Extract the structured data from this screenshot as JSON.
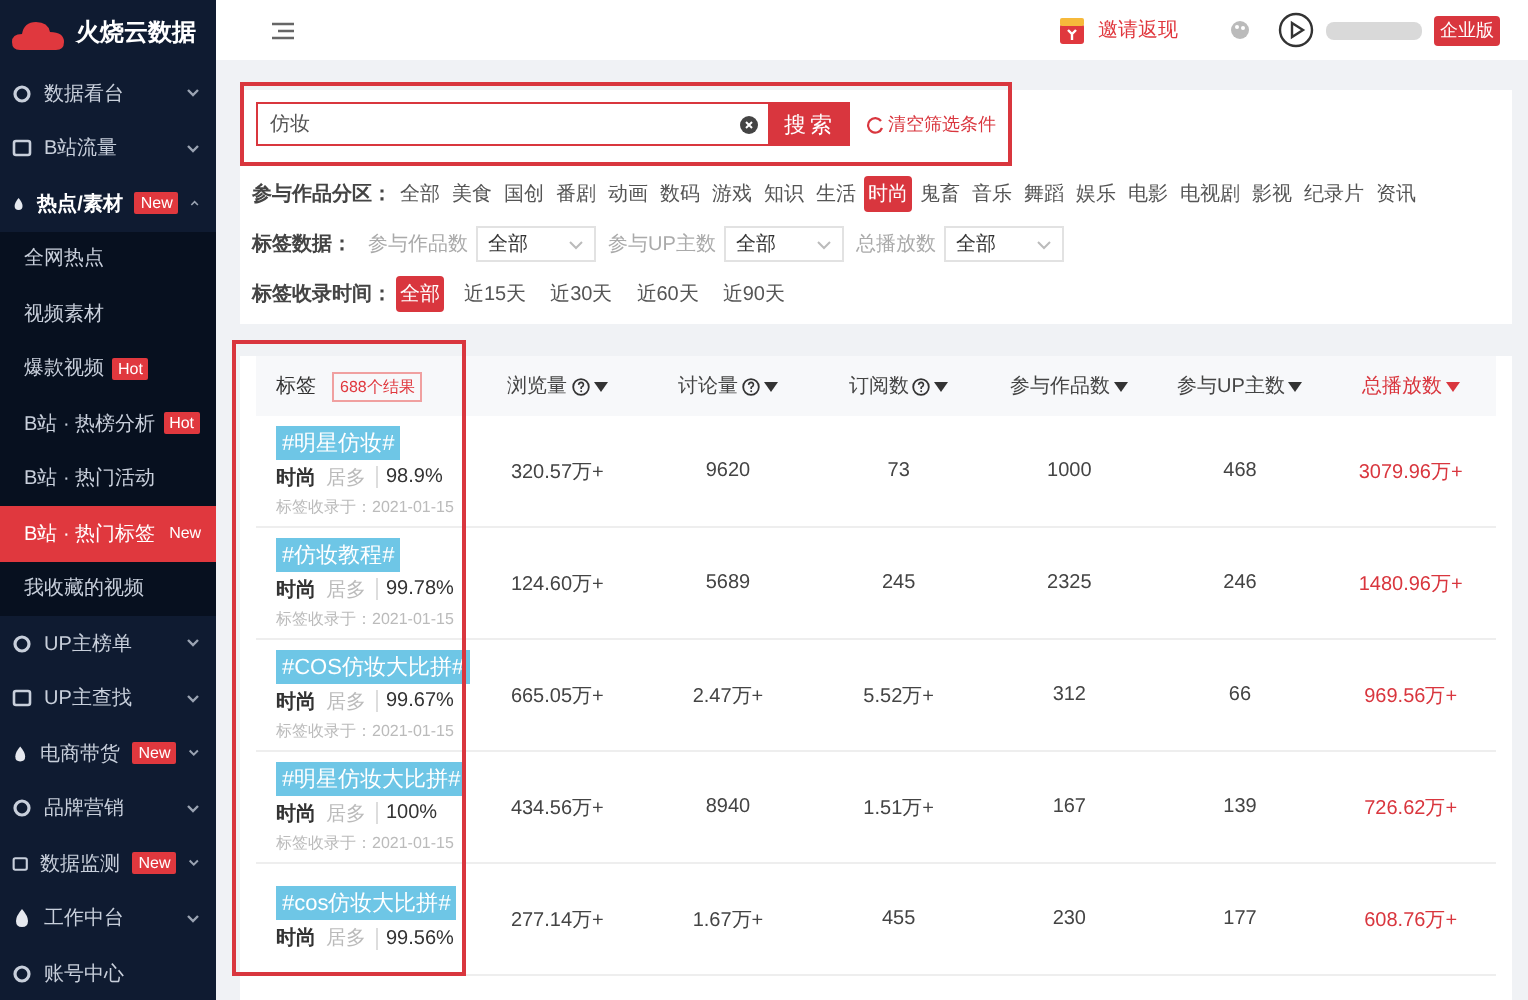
{
  "brand": "火烧云数据",
  "sidebar": {
    "items": [
      {
        "label": "数据看台",
        "expanded": false,
        "selected": false
      },
      {
        "label": "B站流量",
        "expanded": false,
        "selected": false
      },
      {
        "label": "热点/素材",
        "badge": "New",
        "expanded": true,
        "selected": false,
        "children": [
          {
            "label": "全网热点",
            "selected": false
          },
          {
            "label": "视频素材",
            "selected": false
          },
          {
            "label": "爆款视频",
            "badge": "Hot",
            "selected": false
          },
          {
            "label": "B站 · 热榜分析",
            "badge": "Hot",
            "selected": false
          },
          {
            "label": "B站 · 热门活动",
            "selected": false
          },
          {
            "label": "B站 · 热门标签",
            "badge": "New",
            "selected": true
          },
          {
            "label": "我收藏的视频",
            "selected": false
          }
        ]
      },
      {
        "label": "UP主榜单",
        "expanded": false,
        "selected": false
      },
      {
        "label": "UP主查找",
        "expanded": false,
        "selected": false
      },
      {
        "label": "电商带货",
        "badge": "New",
        "expanded": false,
        "selected": false
      },
      {
        "label": "品牌营销",
        "expanded": false,
        "selected": false
      },
      {
        "label": "数据监测",
        "badge": "New",
        "expanded": false,
        "selected": false
      },
      {
        "label": "工作中台",
        "expanded": false,
        "selected": false
      },
      {
        "label": "账号中心",
        "selected": false
      }
    ]
  },
  "topbar": {
    "invite": "邀请返现",
    "edition": "企业版"
  },
  "search": {
    "value": "仿妆",
    "button": "搜索",
    "reset": "清空筛选条件"
  },
  "category": {
    "label": "参与作品分区：",
    "options": [
      {
        "label": "全部",
        "selected": false
      },
      {
        "label": "美食",
        "selected": false
      },
      {
        "label": "国创",
        "selected": false
      },
      {
        "label": "番剧",
        "selected": false
      },
      {
        "label": "动画",
        "selected": false
      },
      {
        "label": "数码",
        "selected": false
      },
      {
        "label": "游戏",
        "selected": false
      },
      {
        "label": "知识",
        "selected": false
      },
      {
        "label": "生活",
        "selected": false
      },
      {
        "label": "时尚",
        "selected": true
      },
      {
        "label": "鬼畜",
        "selected": false
      },
      {
        "label": "音乐",
        "selected": false
      },
      {
        "label": "舞蹈",
        "selected": false
      },
      {
        "label": "娱乐",
        "selected": false
      },
      {
        "label": "电影",
        "selected": false
      },
      {
        "label": "电视剧",
        "selected": false
      },
      {
        "label": "影视",
        "selected": false
      },
      {
        "label": "纪录片",
        "selected": false
      },
      {
        "label": "资讯",
        "selected": false
      }
    ]
  },
  "tag_data": {
    "label": "标签数据：",
    "selects": [
      {
        "label": "参与作品数",
        "value": "全部"
      },
      {
        "label": "参与UP主数",
        "value": "全部"
      },
      {
        "label": "总播放数",
        "value": "全部"
      }
    ]
  },
  "time": {
    "label": "标签收录时间：",
    "options": [
      {
        "label": "全部",
        "selected": true
      },
      {
        "label": "近15天",
        "selected": false
      },
      {
        "label": "近30天",
        "selected": false
      },
      {
        "label": "近60天",
        "selected": false
      },
      {
        "label": "近90天",
        "selected": false
      }
    ]
  },
  "table": {
    "tag_header": "标签",
    "result_count": "688个结果",
    "columns": [
      {
        "label": "浏览量",
        "help": true,
        "active": false
      },
      {
        "label": "讨论量",
        "help": true,
        "active": false
      },
      {
        "label": "订阅数",
        "help": true,
        "active": false
      },
      {
        "label": "参与作品数",
        "help": false,
        "active": false
      },
      {
        "label": "参与UP主数",
        "help": false,
        "active": false
      },
      {
        "label": "总播放数",
        "help": false,
        "active": true
      }
    ],
    "rows": [
      {
        "tag": "#明星仿妆#",
        "category": "时尚",
        "share_label": "居多",
        "share": "98.9%",
        "date": "标签收录于：2021-01-15",
        "values": [
          "320.57万+",
          "9620",
          "73",
          "1000",
          "468",
          "3079.96万+"
        ]
      },
      {
        "tag": "#仿妆教程#",
        "category": "时尚",
        "share_label": "居多",
        "share": "99.78%",
        "date": "标签收录于：2021-01-15",
        "values": [
          "124.60万+",
          "5689",
          "245",
          "2325",
          "246",
          "1480.96万+"
        ]
      },
      {
        "tag": "#COS仿妆大比拼#",
        "category": "时尚",
        "share_label": "居多",
        "share": "99.67%",
        "date": "标签收录于：2021-01-15",
        "values": [
          "665.05万+",
          "2.47万+",
          "5.52万+",
          "312",
          "66",
          "969.56万+"
        ]
      },
      {
        "tag": "#明星仿妆大比拼#",
        "category": "时尚",
        "share_label": "居多",
        "share": "100%",
        "date": "标签收录于：2021-01-15",
        "values": [
          "434.56万+",
          "8940",
          "1.51万+",
          "167",
          "139",
          "726.62万+"
        ]
      },
      {
        "tag": "#cos仿妆大比拼#",
        "category": "时尚",
        "share_label": "居多",
        "share": "99.56%",
        "values": [
          "277.14万+",
          "1.67万+",
          "455",
          "230",
          "177",
          "608.76万+"
        ]
      }
    ]
  }
}
